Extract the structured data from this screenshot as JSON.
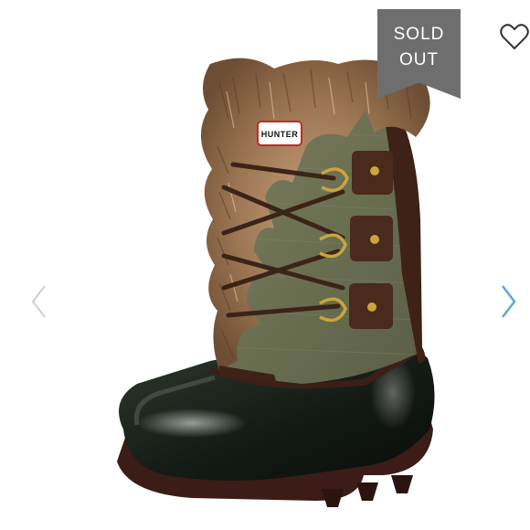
{
  "listing": {
    "status_badge": {
      "line1": "SOLD",
      "line2": "OUT"
    },
    "photo": {
      "subject": "boot-icon",
      "brand_label": "HUNTER"
    },
    "like_icon": "heart-outline-icon",
    "prev_icon": "chevron-left-icon",
    "next_icon": "chevron-right-icon"
  },
  "colors": {
    "badge_bg": "#6e6e6e",
    "badge_text": "#ffffff",
    "prev_arrow": "#cfcfcf",
    "next_arrow": "#5aa9d6",
    "heart": "#333333"
  }
}
